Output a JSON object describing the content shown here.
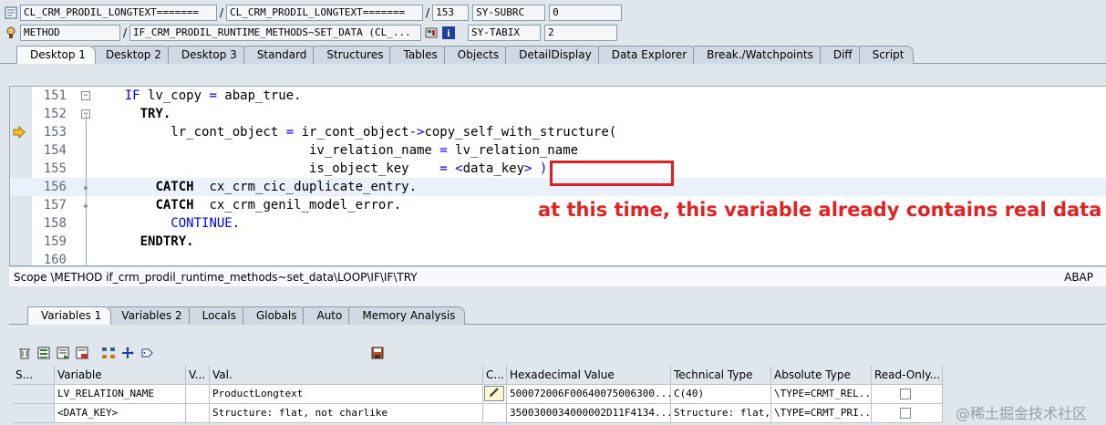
{
  "info": {
    "row1": {
      "program": "CL_CRM_PRODIL_LONGTEXT=======",
      "include": "CL_CRM_PRODIL_LONGTEXT=======",
      "line": "153",
      "field_name": "SY-SUBRC",
      "field_value": "0"
    },
    "row2": {
      "event_type": "METHOD",
      "event": "IF_CRM_PRODIL_RUNTIME_METHODS~SET_DATA (CL_...",
      "field_name": "SY-TABIX",
      "field_value": "2"
    },
    "separator": "/"
  },
  "desktop_tabs": [
    "Desktop 1",
    "Desktop 2",
    "Desktop 3",
    "Standard",
    "Structures",
    "Tables",
    "Objects",
    "DetailDisplay",
    "Data Explorer",
    "Break./Watchpoints",
    "Diff",
    "Script"
  ],
  "code": {
    "lines": [
      {
        "num": "151",
        "parts": [
          {
            "t": "    ",
            "c": ""
          },
          {
            "t": "IF",
            "c": "kw"
          },
          {
            "t": " lv_copy ",
            "c": ""
          },
          {
            "t": "=",
            "c": "op"
          },
          {
            "t": " abap_true.",
            "c": ""
          }
        ]
      },
      {
        "num": "152",
        "parts": [
          {
            "t": "      ",
            "c": ""
          },
          {
            "t": "TRY.",
            "c": "kwb"
          }
        ]
      },
      {
        "num": "153",
        "parts": [
          {
            "t": "          lr_cont_object ",
            "c": ""
          },
          {
            "t": "=",
            "c": "op"
          },
          {
            "t": " ir_cont_object",
            "c": ""
          },
          {
            "t": "->",
            "c": "op"
          },
          {
            "t": "copy_self_with_structure(",
            "c": ""
          }
        ]
      },
      {
        "num": "154",
        "parts": [
          {
            "t": "                            iv_relation_name ",
            "c": ""
          },
          {
            "t": "=",
            "c": "op"
          },
          {
            "t": " lv_relation_name",
            "c": ""
          }
        ]
      },
      {
        "num": "155",
        "parts": [
          {
            "t": "                            is_object_key    ",
            "c": ""
          },
          {
            "t": "=",
            "c": "op"
          },
          {
            "t": " ",
            "c": ""
          },
          {
            "t": "<",
            "c": "op"
          },
          {
            "t": "data_key",
            "c": ""
          },
          {
            "t": "> )",
            "c": "op"
          }
        ]
      },
      {
        "num": "156",
        "parts": [
          {
            "t": "        ",
            "c": ""
          },
          {
            "t": "CATCH",
            "c": "kwb"
          },
          {
            "t": "  cx_crm_cic_duplicate_entry.",
            "c": ""
          }
        ]
      },
      {
        "num": "157",
        "parts": [
          {
            "t": "        ",
            "c": ""
          },
          {
            "t": "CATCH",
            "c": "kwb"
          },
          {
            "t": "  cx_crm_genil_model_error.",
            "c": ""
          }
        ]
      },
      {
        "num": "158",
        "parts": [
          {
            "t": "          ",
            "c": ""
          },
          {
            "t": "CONTINUE.",
            "c": "kw"
          }
        ]
      },
      {
        "num": "159",
        "parts": [
          {
            "t": "      ",
            "c": ""
          },
          {
            "t": "ENDTRY.",
            "c": "kwb"
          }
        ]
      },
      {
        "num": "160",
        "parts": [
          {
            "t": "",
            "c": ""
          }
        ]
      }
    ],
    "current_line": "153"
  },
  "scope": {
    "text": "Scope \\METHOD if_crm_prodil_runtime_methods~set_data\\LOOP\\IF\\IF\\TRY",
    "language": "ABAP"
  },
  "annotation": "at this time, this variable already contains real data",
  "variable_tabs": [
    "Variables 1",
    "Variables 2",
    "Locals",
    "Globals",
    "Auto",
    "Memory Analysis"
  ],
  "grid": {
    "headers": [
      "S...",
      "Variable",
      "V...",
      "Val.",
      "C...",
      "Hexadecimal Value",
      "Technical Type",
      "Absolute Type",
      "Read-Only..."
    ],
    "rows": [
      {
        "variable": "LV_RELATION_NAME",
        "value": "ProductLongtext",
        "hex": "500072006F00640075006300...",
        "tech": "C(40)",
        "abs": "\\TYPE=CRMT_REL..."
      },
      {
        "variable": "<DATA_KEY>",
        "value": "Structure: flat, not charlike",
        "hex": "3500300034000002D11F4134...",
        "tech": "Structure: flat, no...",
        "abs": "\\TYPE=CRMT_PRI..."
      }
    ]
  },
  "watermark": "@稀土掘金技术社区",
  "icons": {
    "program": "program-icon",
    "method": "method-icon",
    "current_line": "current-line-arrow-icon"
  }
}
